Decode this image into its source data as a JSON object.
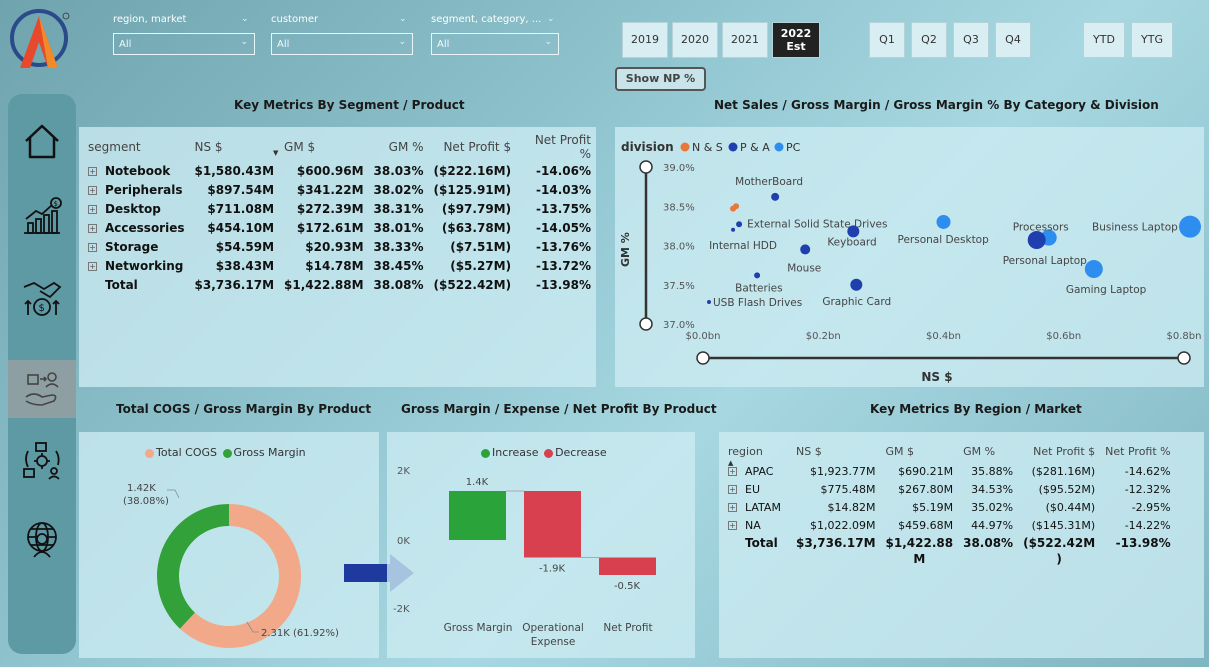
{
  "filters": [
    {
      "label": "region, market",
      "value": "All"
    },
    {
      "label": "customer",
      "value": "All"
    },
    {
      "label": "segment, category, ...",
      "value": "All"
    }
  ],
  "years": [
    "2019",
    "2020",
    "2021"
  ],
  "selected_year": {
    "line1": "2022",
    "line2": "Est"
  },
  "quarters": [
    "Q1",
    "Q2",
    "Q3",
    "Q4"
  ],
  "ytd": "YTD",
  "ytg": "YTG",
  "show_np": "Show NP %",
  "segment_panel": {
    "title": "Key Metrics By Segment / Product",
    "headers": [
      "segment",
      "NS $",
      "GM $",
      "GM %",
      "Net Profit $",
      "Net Profit %"
    ],
    "rows": [
      [
        "Notebook",
        "$1,580.43M",
        "$600.96M",
        "38.03%",
        "($222.16M)",
        "-14.06%"
      ],
      [
        "Peripherals",
        "$897.54M",
        "$341.22M",
        "38.02%",
        "($125.91M)",
        "-14.03%"
      ],
      [
        "Desktop",
        "$711.08M",
        "$272.39M",
        "38.31%",
        "($97.79M)",
        "-13.75%"
      ],
      [
        "Accessories",
        "$454.10M",
        "$172.61M",
        "38.01%",
        "($63.78M)",
        "-14.05%"
      ],
      [
        "Storage",
        "$54.59M",
        "$20.93M",
        "38.33%",
        "($7.51M)",
        "-13.76%"
      ],
      [
        "Networking",
        "$38.43M",
        "$14.78M",
        "38.45%",
        "($5.27M)",
        "-13.72%"
      ]
    ],
    "total": [
      "Total",
      "$3,736.17M",
      "$1,422.88M",
      "38.08%",
      "($522.42M)",
      "-13.98%"
    ]
  },
  "scatter_panel": {
    "title": "Net Sales / Gross Margin / Gross Margin % By Category & Division",
    "legend_title": "division",
    "legend": [
      {
        "name": "N & S",
        "color": "#e8773a"
      },
      {
        "name": "P & A",
        "color": "#1f3fae"
      },
      {
        "name": "PC",
        "color": "#2d8ef0"
      }
    ],
    "ylabel": "GM %",
    "xlabel": "NS $",
    "yticks": [
      "39.0%",
      "38.5%",
      "38.0%",
      "37.5%",
      "37.0%"
    ],
    "xticks": [
      "$0.0bn",
      "$0.2bn",
      "$0.4bn",
      "$0.6bn",
      "$0.8bn"
    ]
  },
  "chart_data": [
    {
      "type": "scatter",
      "title": "Net Sales / Gross Margin / Gross Margin % By Category & Division",
      "xlabel": "NS $",
      "ylabel": "GM %",
      "xlim": [
        0,
        0.8
      ],
      "ylim": [
        37.0,
        39.0
      ],
      "points": [
        {
          "label": "MotherBoard",
          "x": 0.12,
          "y": 38.62,
          "division": "P & A",
          "size": 4
        },
        {
          "label": "",
          "x": 0.05,
          "y": 38.47,
          "division": "N & S",
          "size": 3
        },
        {
          "label": "",
          "x": 0.055,
          "y": 38.5,
          "division": "N & S",
          "size": 3
        },
        {
          "label": "External Solid State Drives",
          "x": 0.06,
          "y": 38.27,
          "division": "P & A",
          "size": 3
        },
        {
          "label": "Internal HDD",
          "x": 0.05,
          "y": 38.2,
          "division": "P & A",
          "size": 2
        },
        {
          "label": "Keyboard",
          "x": 0.25,
          "y": 38.18,
          "division": "P & A",
          "size": 6
        },
        {
          "label": "Mouse",
          "x": 0.17,
          "y": 37.95,
          "division": "P & A",
          "size": 5
        },
        {
          "label": "Batteries",
          "x": 0.09,
          "y": 37.62,
          "division": "P & A",
          "size": 3
        },
        {
          "label": "Graphic Card",
          "x": 0.255,
          "y": 37.5,
          "division": "P & A",
          "size": 6
        },
        {
          "label": "USB Flash Drives",
          "x": 0.01,
          "y": 37.28,
          "division": "P & A",
          "size": 2
        },
        {
          "label": "Personal Desktop",
          "x": 0.4,
          "y": 38.3,
          "division": "PC",
          "size": 7
        },
        {
          "label": "Processors",
          "x": 0.575,
          "y": 38.1,
          "division": "PC",
          "size": 8
        },
        {
          "label": "Personal Laptop",
          "x": 0.555,
          "y": 38.07,
          "division": "P & A",
          "size": 9
        },
        {
          "label": "Business Laptop",
          "x": 0.81,
          "y": 38.24,
          "division": "PC",
          "size": 11
        },
        {
          "label": "Gaming Laptop",
          "x": 0.65,
          "y": 37.7,
          "division": "PC",
          "size": 9
        }
      ]
    },
    {
      "type": "pie",
      "title": "Total COGS / Gross Margin By Product",
      "labels": [
        "Total COGS",
        "Gross Margin"
      ],
      "values": [
        2310,
        1420
      ],
      "colors": [
        "#f2a98a",
        "#32a13a"
      ],
      "data_labels": [
        "2.31K (61.92%)",
        "1.42K (38.08%)"
      ]
    },
    {
      "type": "bar",
      "title": "Gross Margin / Expense / Net Profit By Product",
      "categories": [
        "Gross Margin",
        "Operational Expense",
        "Net Profit"
      ],
      "values": [
        1400,
        -1900,
        -500
      ],
      "data_labels": [
        "1.4K",
        "-1.9K",
        "-0.5K"
      ],
      "ylim": [
        -2000,
        2000
      ],
      "yticks": [
        "2K",
        "0K",
        "-2K"
      ],
      "legend": [
        {
          "name": "Increase",
          "color": "#2aa33a"
        },
        {
          "name": "Decrease",
          "color": "#d9404f"
        }
      ]
    }
  ],
  "cogs_panel": {
    "title": "Total COGS / Gross Margin By Product",
    "legend": [
      {
        "name": "Total COGS",
        "color": "#f2a98a"
      },
      {
        "name": "Gross Margin",
        "color": "#32a13a"
      }
    ],
    "label_gm_line1": "1.42K",
    "label_gm_line2": "(38.08%)",
    "label_cogs": "2.31K (61.92%)"
  },
  "waterfall_panel": {
    "title": "Gross Margin / Expense / Net Profit By Product",
    "legend": [
      {
        "name": "Increase",
        "color": "#2aa33a"
      },
      {
        "name": "Decrease",
        "color": "#d9404f"
      }
    ],
    "yticks": [
      "2K",
      "0K",
      "-2K"
    ],
    "categories": [
      "Gross Margin",
      "Operational",
      "Expense",
      "Net Profit"
    ],
    "data_labels": [
      "1.4K",
      "-1.9K",
      "-0.5K"
    ]
  },
  "region_panel": {
    "title": "Key Metrics By Region / Market",
    "headers": [
      "region",
      "NS $",
      "GM $",
      "GM %",
      "Net Profit $",
      "Net Profit %"
    ],
    "rows": [
      [
        "APAC",
        "$1,923.77M",
        "$690.21M",
        "35.88%",
        "($281.16M)",
        "-14.62%"
      ],
      [
        "EU",
        "$775.48M",
        "$267.80M",
        "34.53%",
        "($95.52M)",
        "-12.32%"
      ],
      [
        "LATAM",
        "$14.82M",
        "$5.19M",
        "35.02%",
        "($0.44M)",
        "-2.95%"
      ],
      [
        "NA",
        "$1,022.09M",
        "$459.68M",
        "44.97%",
        "($145.31M)",
        "-14.22%"
      ]
    ],
    "total": [
      "Total",
      "$3,736.17M",
      "$1,422.88",
      "38.08%",
      "($522.42M",
      "-13.98%"
    ],
    "total_wrap": [
      "",
      "",
      "M",
      "",
      ")",
      ""
    ]
  }
}
